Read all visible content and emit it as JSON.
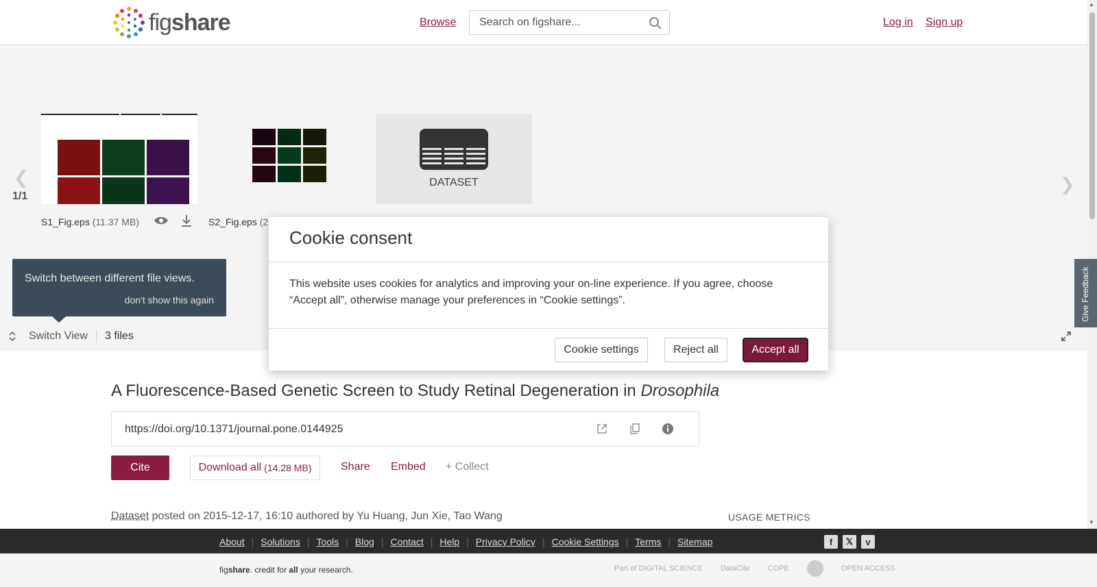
{
  "header": {
    "logo_text_light": "fig",
    "logo_text_bold": "share",
    "browse": "Browse",
    "search_placeholder": "Search on figshare...",
    "login": "Log in",
    "signup": "Sign up"
  },
  "viewer": {
    "pager": "1/1",
    "files": [
      {
        "name": "S1_Fig.eps",
        "size": "(11.37 MB)"
      },
      {
        "name": "S2_Fig.eps",
        "size": "(2"
      }
    ],
    "dataset_label": "DATASET",
    "tooltip_text": "Switch between different file views.",
    "tooltip_dismiss": "don't show this again",
    "switch_view": "Switch View",
    "files_count": "3 files",
    "feedback": "Give Feedback"
  },
  "article": {
    "title_main": "A Fluorescence-Based Genetic Screen to Study Retinal Degeneration in ",
    "title_italic": "Drosophila",
    "doi": "https://doi.org/10.1371/journal.pone.0144925",
    "cite": "Cite",
    "download_label": "Download all",
    "download_size": "(14.28 MB)",
    "share": "Share",
    "embed": "Embed",
    "collect": "+ Collect",
    "posted_type": "Dataset",
    "posted_rest": " posted on 2015-12-17, 16:10 authored by Yu Huang, Jun Xie, Tao Wang",
    "usage_metrics": "USAGE METRICS"
  },
  "footer": {
    "links": [
      "About",
      "Solutions",
      "Tools",
      "Blog",
      "Contact",
      "Help",
      "Privacy Policy",
      "Cookie Settings",
      "Terms",
      "Sitemap"
    ],
    "social": [
      "facebook-icon",
      "x-icon",
      "vimeo-icon"
    ],
    "tagline_pre": "fig",
    "tagline_bold": "share",
    "tagline_mid": ". credit for ",
    "tagline_all": "all",
    "tagline_post": " your research.",
    "partners": [
      "Part of DIGITAL SCIENCE",
      "DataCite",
      "COPE",
      "",
      "OPEN ACCESS"
    ]
  },
  "cookie_modal": {
    "title": "Cookie consent",
    "text": "This website uses cookies for analytics and improving your on-line experience. If you agree, choose “Accept all”, otherwise manage your preferences in “Cookie settings”.",
    "settings_button": "Cookie settings",
    "reject_button": "Reject all",
    "accept_button": "Accept all"
  },
  "colors": {
    "brand": "#8b1d41",
    "accept_bg": "#7a1a3c",
    "footer_bg": "#2b2b2b"
  }
}
